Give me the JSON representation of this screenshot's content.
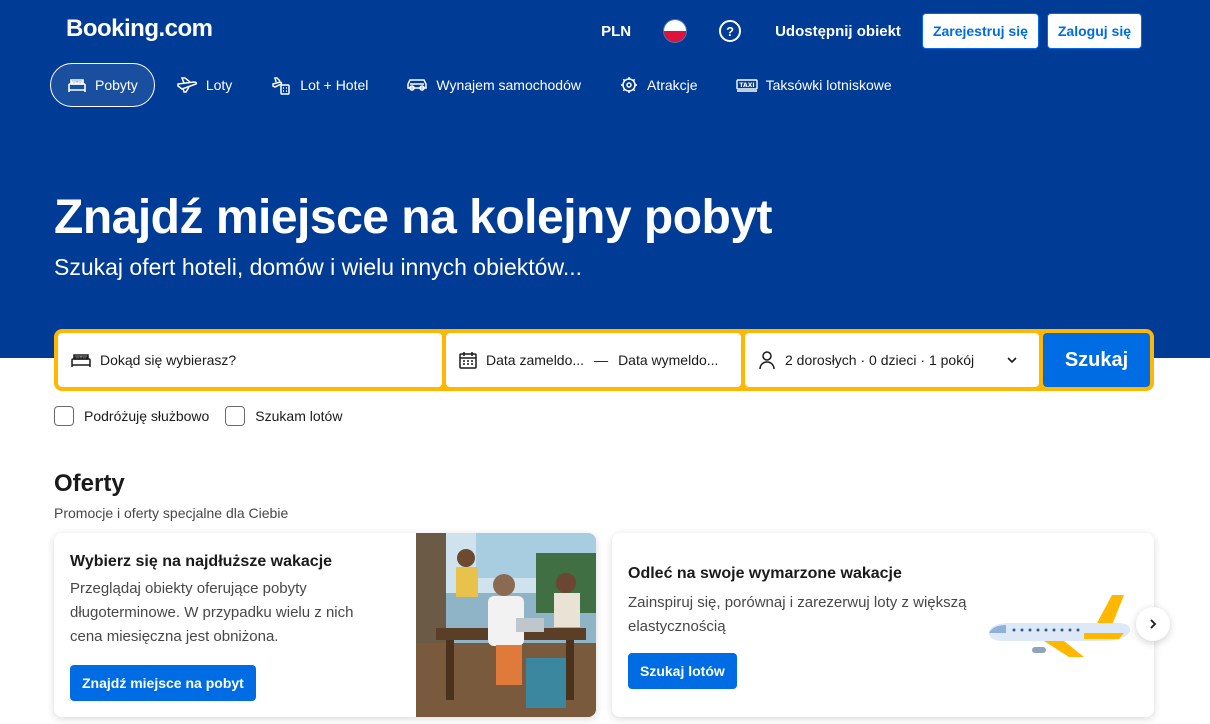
{
  "header": {
    "logo": "Booking.com",
    "currency": "PLN",
    "help_icon_label": "?",
    "list_property": "Udostępnij obiekt",
    "register": "Zarejestruj się",
    "login": "Zaloguj się"
  },
  "nav": {
    "items": [
      {
        "label": "Pobyty",
        "icon": "bed-icon",
        "active": true
      },
      {
        "label": "Loty",
        "icon": "plane-icon"
      },
      {
        "label": "Lot + Hotel",
        "icon": "plane-hotel-icon"
      },
      {
        "label": "Wynajem samochodów",
        "icon": "car-icon"
      },
      {
        "label": "Atrakcje",
        "icon": "attractions-icon"
      },
      {
        "label": "Taksówki lotniskowe",
        "icon": "taxi-icon"
      }
    ]
  },
  "hero": {
    "title": "Znajdź miejsce na kolejny pobyt",
    "subtitle": "Szukaj ofert hoteli, domów i wielu innych obiektów..."
  },
  "search": {
    "destination_placeholder": "Dokąd się wybierasz?",
    "checkin": "Data zameldo...",
    "separator": "—",
    "checkout": "Data wymeldo...",
    "guests": "2 dorosłych · 0 dzieci · 1 pokój",
    "button": "Szukaj",
    "business_trip": "Podróżuję służbowo",
    "flights": "Szukam lotów"
  },
  "offers": {
    "title": "Oferty",
    "subtitle": "Promocje i oferty specjalne dla Ciebie",
    "cards": [
      {
        "title": "Wybierz się na najdłuższe wakacje",
        "text": "Przeglądaj obiekty oferujące pobyty długoterminowe. W przypadku wielu z nich cena miesięczna jest obniżona.",
        "button": "Znajdź miejsce na pobyt"
      },
      {
        "title": "Odleć na swoje wymarzone wakacje",
        "text": "Zainspiruj się, porównaj i zarezerwuj loty z większą elastycznością",
        "button": "Szukaj lotów"
      }
    ]
  },
  "colors": {
    "brand_blue": "#003b95",
    "action_blue": "#006ce4",
    "search_border": "#ffb700"
  }
}
